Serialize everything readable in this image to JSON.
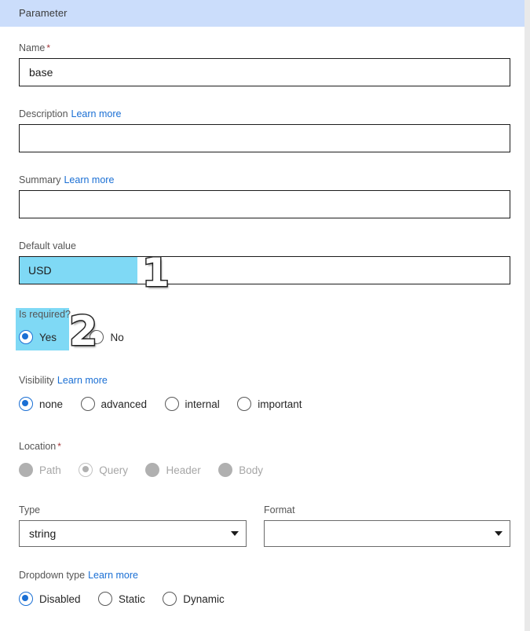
{
  "header": {
    "title": "Parameter"
  },
  "form": {
    "name": {
      "label": "Name",
      "required_mark": "*",
      "value": "base",
      "placeholder": ""
    },
    "description": {
      "label": "Description",
      "learn_more": "Learn more",
      "value": "",
      "placeholder": ""
    },
    "summary": {
      "label": "Summary",
      "learn_more": "Learn more",
      "value": "",
      "placeholder": ""
    },
    "default_value": {
      "label": "Default value",
      "value": "USD",
      "placeholder": "",
      "selected_text": "USD"
    },
    "is_required": {
      "label": "Is required?",
      "options": [
        {
          "label": "Yes",
          "checked": true
        },
        {
          "label": "No",
          "checked": false
        }
      ]
    },
    "visibility": {
      "label": "Visibility",
      "learn_more": "Learn more",
      "options": [
        {
          "label": "none",
          "checked": true
        },
        {
          "label": "advanced",
          "checked": false
        },
        {
          "label": "internal",
          "checked": false
        },
        {
          "label": "important",
          "checked": false
        }
      ]
    },
    "location": {
      "label": "Location",
      "required_mark": "*",
      "disabled": true,
      "options": [
        {
          "label": "Path",
          "checked": false
        },
        {
          "label": "Query",
          "checked": true
        },
        {
          "label": "Header",
          "checked": false
        },
        {
          "label": "Body",
          "checked": false
        }
      ]
    },
    "type": {
      "label": "Type",
      "value": "string"
    },
    "format": {
      "label": "Format",
      "value": ""
    },
    "dropdown_type": {
      "label": "Dropdown type",
      "learn_more": "Learn more",
      "options": [
        {
          "label": "Disabled",
          "checked": true
        },
        {
          "label": "Static",
          "checked": false
        },
        {
          "label": "Dynamic",
          "checked": false
        }
      ]
    }
  },
  "annotations": [
    {
      "label": "1"
    },
    {
      "label": "2"
    }
  ],
  "colors": {
    "header_band": "#cbddfb",
    "highlight": "#7fd9f5",
    "accent": "#1a6fd4",
    "link": "#1a6fd4",
    "required_star": "#a4373a",
    "disabled_grey": "#b0b0b0"
  }
}
